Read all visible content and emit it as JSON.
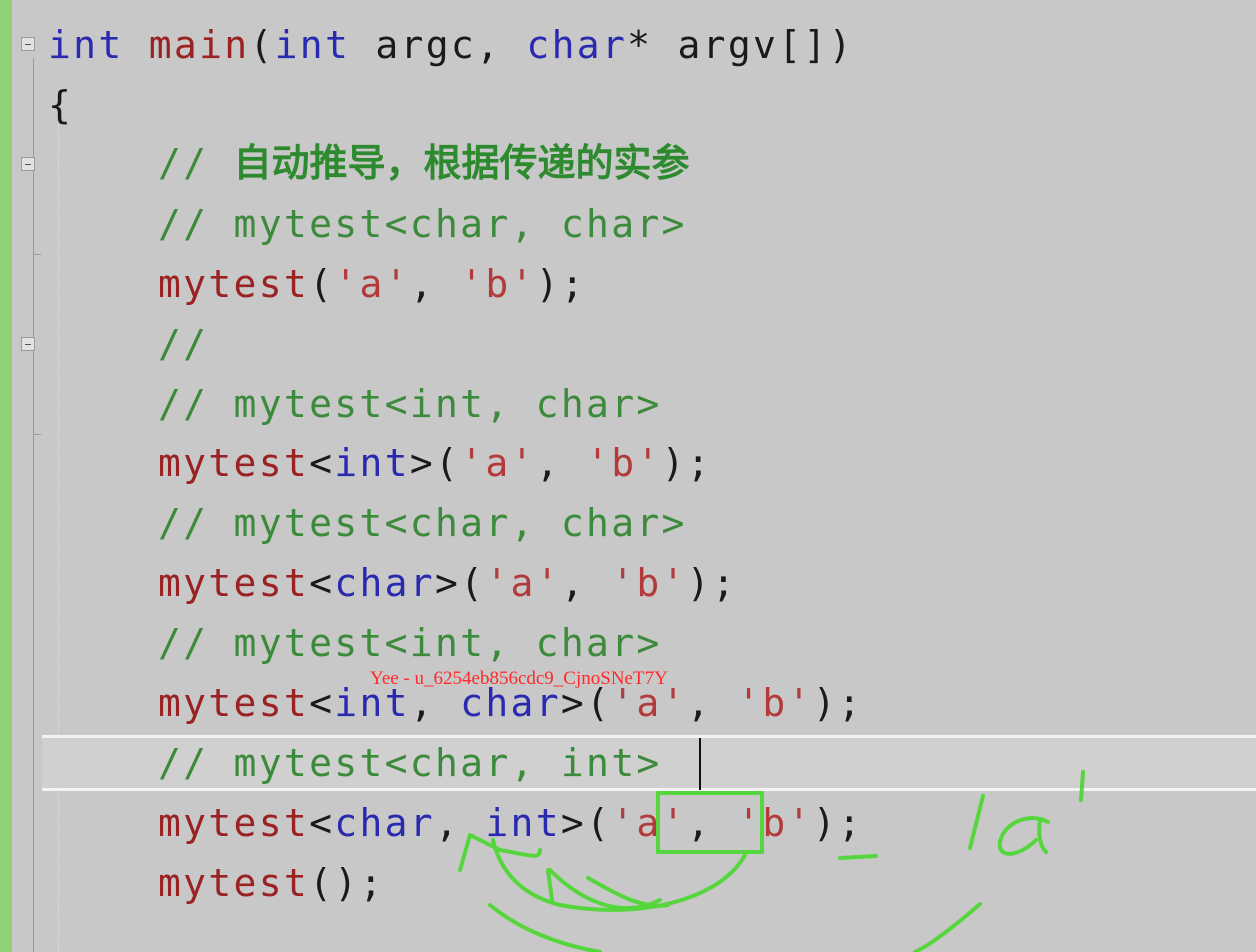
{
  "editor": {
    "lines": [
      [
        {
          "t": "int",
          "c": "kw"
        },
        {
          "t": " main",
          "c": "fn"
        },
        {
          "t": "("
        },
        {
          "t": "int",
          "c": "kw"
        },
        {
          "t": " argc, "
        },
        {
          "t": "char",
          "c": "kw"
        },
        {
          "t": "* argv[])"
        }
      ],
      [
        {
          "t": "{"
        }
      ],
      [
        {
          "t": "// ",
          "c": "cm"
        },
        {
          "t": "自动推导，根据传递的实参",
          "c": "cm cm-cn"
        }
      ],
      [
        {
          "t": "// mytest<char, char>",
          "c": "cm"
        }
      ],
      [
        {
          "t": "mytest",
          "c": "fn"
        },
        {
          "t": "("
        },
        {
          "t": "'a'",
          "c": "str"
        },
        {
          "t": ", "
        },
        {
          "t": "'b'",
          "c": "str"
        },
        {
          "t": ");"
        }
      ],
      [
        {
          "t": "//",
          "c": "cm"
        }
      ],
      [
        {
          "t": "// mytest<int, char>",
          "c": "cm"
        }
      ],
      [
        {
          "t": "mytest",
          "c": "fn"
        },
        {
          "t": "<"
        },
        {
          "t": "int",
          "c": "kw"
        },
        {
          "t": ">("
        },
        {
          "t": "'a'",
          "c": "str"
        },
        {
          "t": ", "
        },
        {
          "t": "'b'",
          "c": "str"
        },
        {
          "t": ");"
        }
      ],
      [
        {
          "t": "// mytest<char, char>",
          "c": "cm"
        }
      ],
      [
        {
          "t": "mytest",
          "c": "fn"
        },
        {
          "t": "<"
        },
        {
          "t": "char",
          "c": "kw"
        },
        {
          "t": ">("
        },
        {
          "t": "'a'",
          "c": "str"
        },
        {
          "t": ", "
        },
        {
          "t": "'b'",
          "c": "str"
        },
        {
          "t": ");"
        }
      ],
      [
        {
          "t": "// mytest<int, char>",
          "c": "cm"
        }
      ],
      [
        {
          "t": "mytest",
          "c": "fn"
        },
        {
          "t": "<"
        },
        {
          "t": "int",
          "c": "kw"
        },
        {
          "t": ", "
        },
        {
          "t": "char",
          "c": "kw"
        },
        {
          "t": ">("
        },
        {
          "t": "'a'",
          "c": "str"
        },
        {
          "t": ", "
        },
        {
          "t": "'b'",
          "c": "str"
        },
        {
          "t": ");"
        }
      ],
      [
        {
          "t": "// mytest<char, int>",
          "c": "cm"
        }
      ],
      [
        {
          "t": "mytest",
          "c": "fn"
        },
        {
          "t": "<"
        },
        {
          "t": "char",
          "c": "kw"
        },
        {
          "t": ", "
        },
        {
          "t": "int",
          "c": "kw"
        },
        {
          "t": ">("
        },
        {
          "t": "'a'",
          "c": "str"
        },
        {
          "t": ", "
        },
        {
          "t": "'b'",
          "c": "str"
        },
        {
          "t": ");"
        }
      ],
      [
        {
          "t": "mytest",
          "c": "fn"
        },
        {
          "t": "();"
        }
      ]
    ]
  },
  "watermark": "Yee - u_6254eb856cdc9_CjnoSNeT7Y",
  "annotation": {
    "handwritten_text": "'a'",
    "ink_color": "#55d63c"
  }
}
